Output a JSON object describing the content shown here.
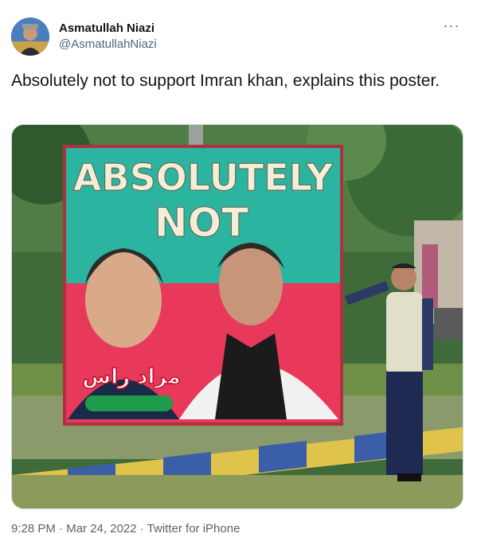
{
  "author": {
    "display_name": "Asmatullah Niazi",
    "handle": "@AsmatullahNiazi",
    "avatar_icon": "user-avatar"
  },
  "menu": {
    "icon": "more-icon",
    "glyph": "···"
  },
  "tweet": {
    "text": "Absolutely not to support Imran khan, explains this poster."
  },
  "media": {
    "poster_line1": "ABSOLUTELY",
    "poster_line2": "NOT",
    "urdu_name": "مراد راس",
    "colors": {
      "teal": "#2bb5a0",
      "red": "#e8395a",
      "green": "#1f9a4a"
    }
  },
  "meta": {
    "time": "9:28 PM",
    "date": "Mar 24, 2022",
    "source": "Twitter for iPhone",
    "separator": "·"
  }
}
